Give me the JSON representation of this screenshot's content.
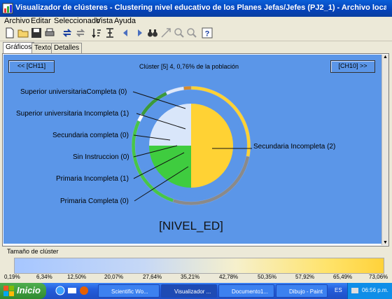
{
  "window": {
    "title": "Visualizador de clústeres - Clustering nivel educativo de los Planes Jefas/Jefes (PJ2_1) - Archivo local: general I..."
  },
  "menu": [
    "Archivo",
    "Editar",
    "Seleccionado",
    "Vista",
    "Ayuda"
  ],
  "toolbar_icons": [
    "new-icon",
    "open-icon",
    "save-icon",
    "print-icon",
    "refresh-icon",
    "swap-icon",
    "sort-icon",
    "filter-icon",
    "arrow-left-icon",
    "arrow-right-icon",
    "binoculars-icon",
    "resize-icon",
    "zoom-in-icon",
    "zoom-out-icon",
    "help-icon"
  ],
  "tabs": [
    "Gráficos",
    "Texto",
    "Detalles"
  ],
  "nav": {
    "prev": "<< [CH11]",
    "next": "[CH10] >>"
  },
  "chart_title": "Clúster [5] 4, 0,76% de la población",
  "chart_bottom_label": "[NIVEL_ED]",
  "chart_data": {
    "type": "pie",
    "title": "Clúster [5] 4, 0,76% de la población",
    "xlabel": "[NIVEL_ED]",
    "categories": [
      "Superior universitariaCompleta (0)",
      "Superior universitaria Incompleta (1)",
      "Secundaria completa (0)",
      "Sin Instruccion (0)",
      "Primaria Incompleta (1)",
      "Primaria Completa (0)",
      "Secundaria Incompleta (2)"
    ],
    "inner_values": [
      0,
      25,
      0,
      0,
      25,
      0,
      50
    ],
    "inner_colors": [
      "#d9e6fa",
      "#d9e6fa",
      "#d9e6fa",
      "#d9e6fa",
      "#3fcc3f",
      "#3fcc3f",
      "#ffd234"
    ],
    "outer_ring": [
      {
        "color": "#ffd234",
        "value": 28
      },
      {
        "color": "#8a8a8a",
        "value": 27
      },
      {
        "color": "#48c648",
        "value": 27
      },
      {
        "color": "#ffffff",
        "value": 2
      },
      {
        "color": "#3b9a3b",
        "value": 9
      },
      {
        "color": "#dfe9fa",
        "value": 5
      },
      {
        "color": "#d68a2c",
        "value": 2
      }
    ]
  },
  "cluster_size": {
    "label": "Tamaño de clúster",
    "ticks": [
      "0,19%",
      "6,34%",
      "12,50%",
      "20,07%",
      "27,64%",
      "35,21%",
      "42,78%",
      "50,35%",
      "57,92%",
      "65,49%",
      "73,06%"
    ]
  },
  "taskbar": {
    "start": "Inicio",
    "tasks": [
      "Scientific Wo...",
      "Visualizador ...",
      "Documento1...",
      "Dibujo - Paint"
    ],
    "lang": "ES",
    "clock": "06:56 p.m."
  }
}
